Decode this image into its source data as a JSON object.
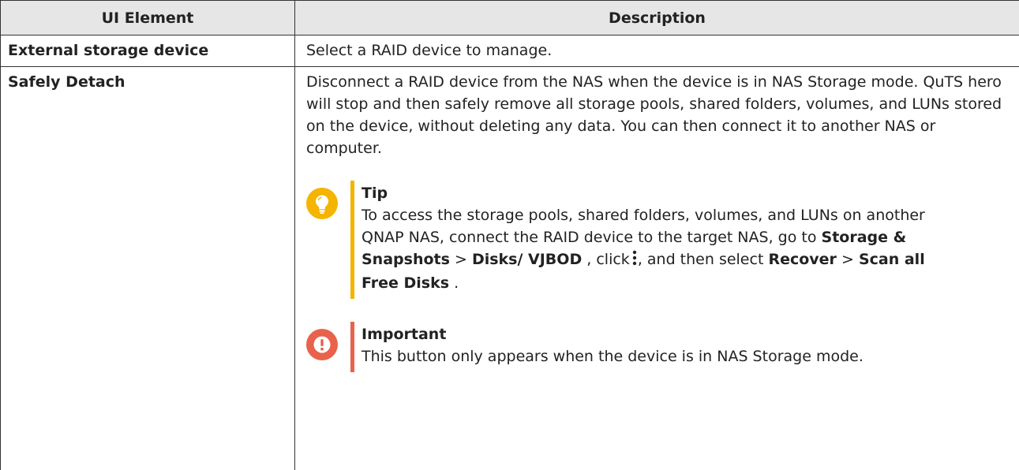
{
  "table": {
    "headers": [
      "UI Element",
      "Description"
    ],
    "rows": [
      {
        "element": "External storage device",
        "description": "Select a RAID device to manage."
      },
      {
        "element": "Safely Detach",
        "description": "Disconnect a RAID device from the NAS when the device is in NAS Storage mode. QuTS hero will stop and then safely remove all storage pools, shared folders, volumes, and LUNs stored on the device, without deleting any data. You can then connect it to another NAS or computer.",
        "tip": {
          "title": "Tip",
          "icon": "lightbulb-icon",
          "color": "#f4b400",
          "text_1": "To access the storage pools, shared folders, volumes, and LUNs on another QNAP NAS, connect the RAID device to the target NAS, go to",
          "bold_1": "Storage & Snapshots",
          "sep_1": ">",
          "bold_2": "Disks/ VJBOD",
          "text_2": ", click",
          "kebab_icon": "more-vertical-icon",
          "text_3": ", and then select",
          "bold_3": "Recover",
          "sep_2": ">",
          "bold_4": "Scan all Free Disks",
          "text_4": "."
        },
        "important": {
          "title": "Important",
          "icon": "exclamation-icon",
          "color": "#e8624c",
          "text": "This button only appears when the device is in NAS Storage mode."
        }
      }
    ]
  }
}
